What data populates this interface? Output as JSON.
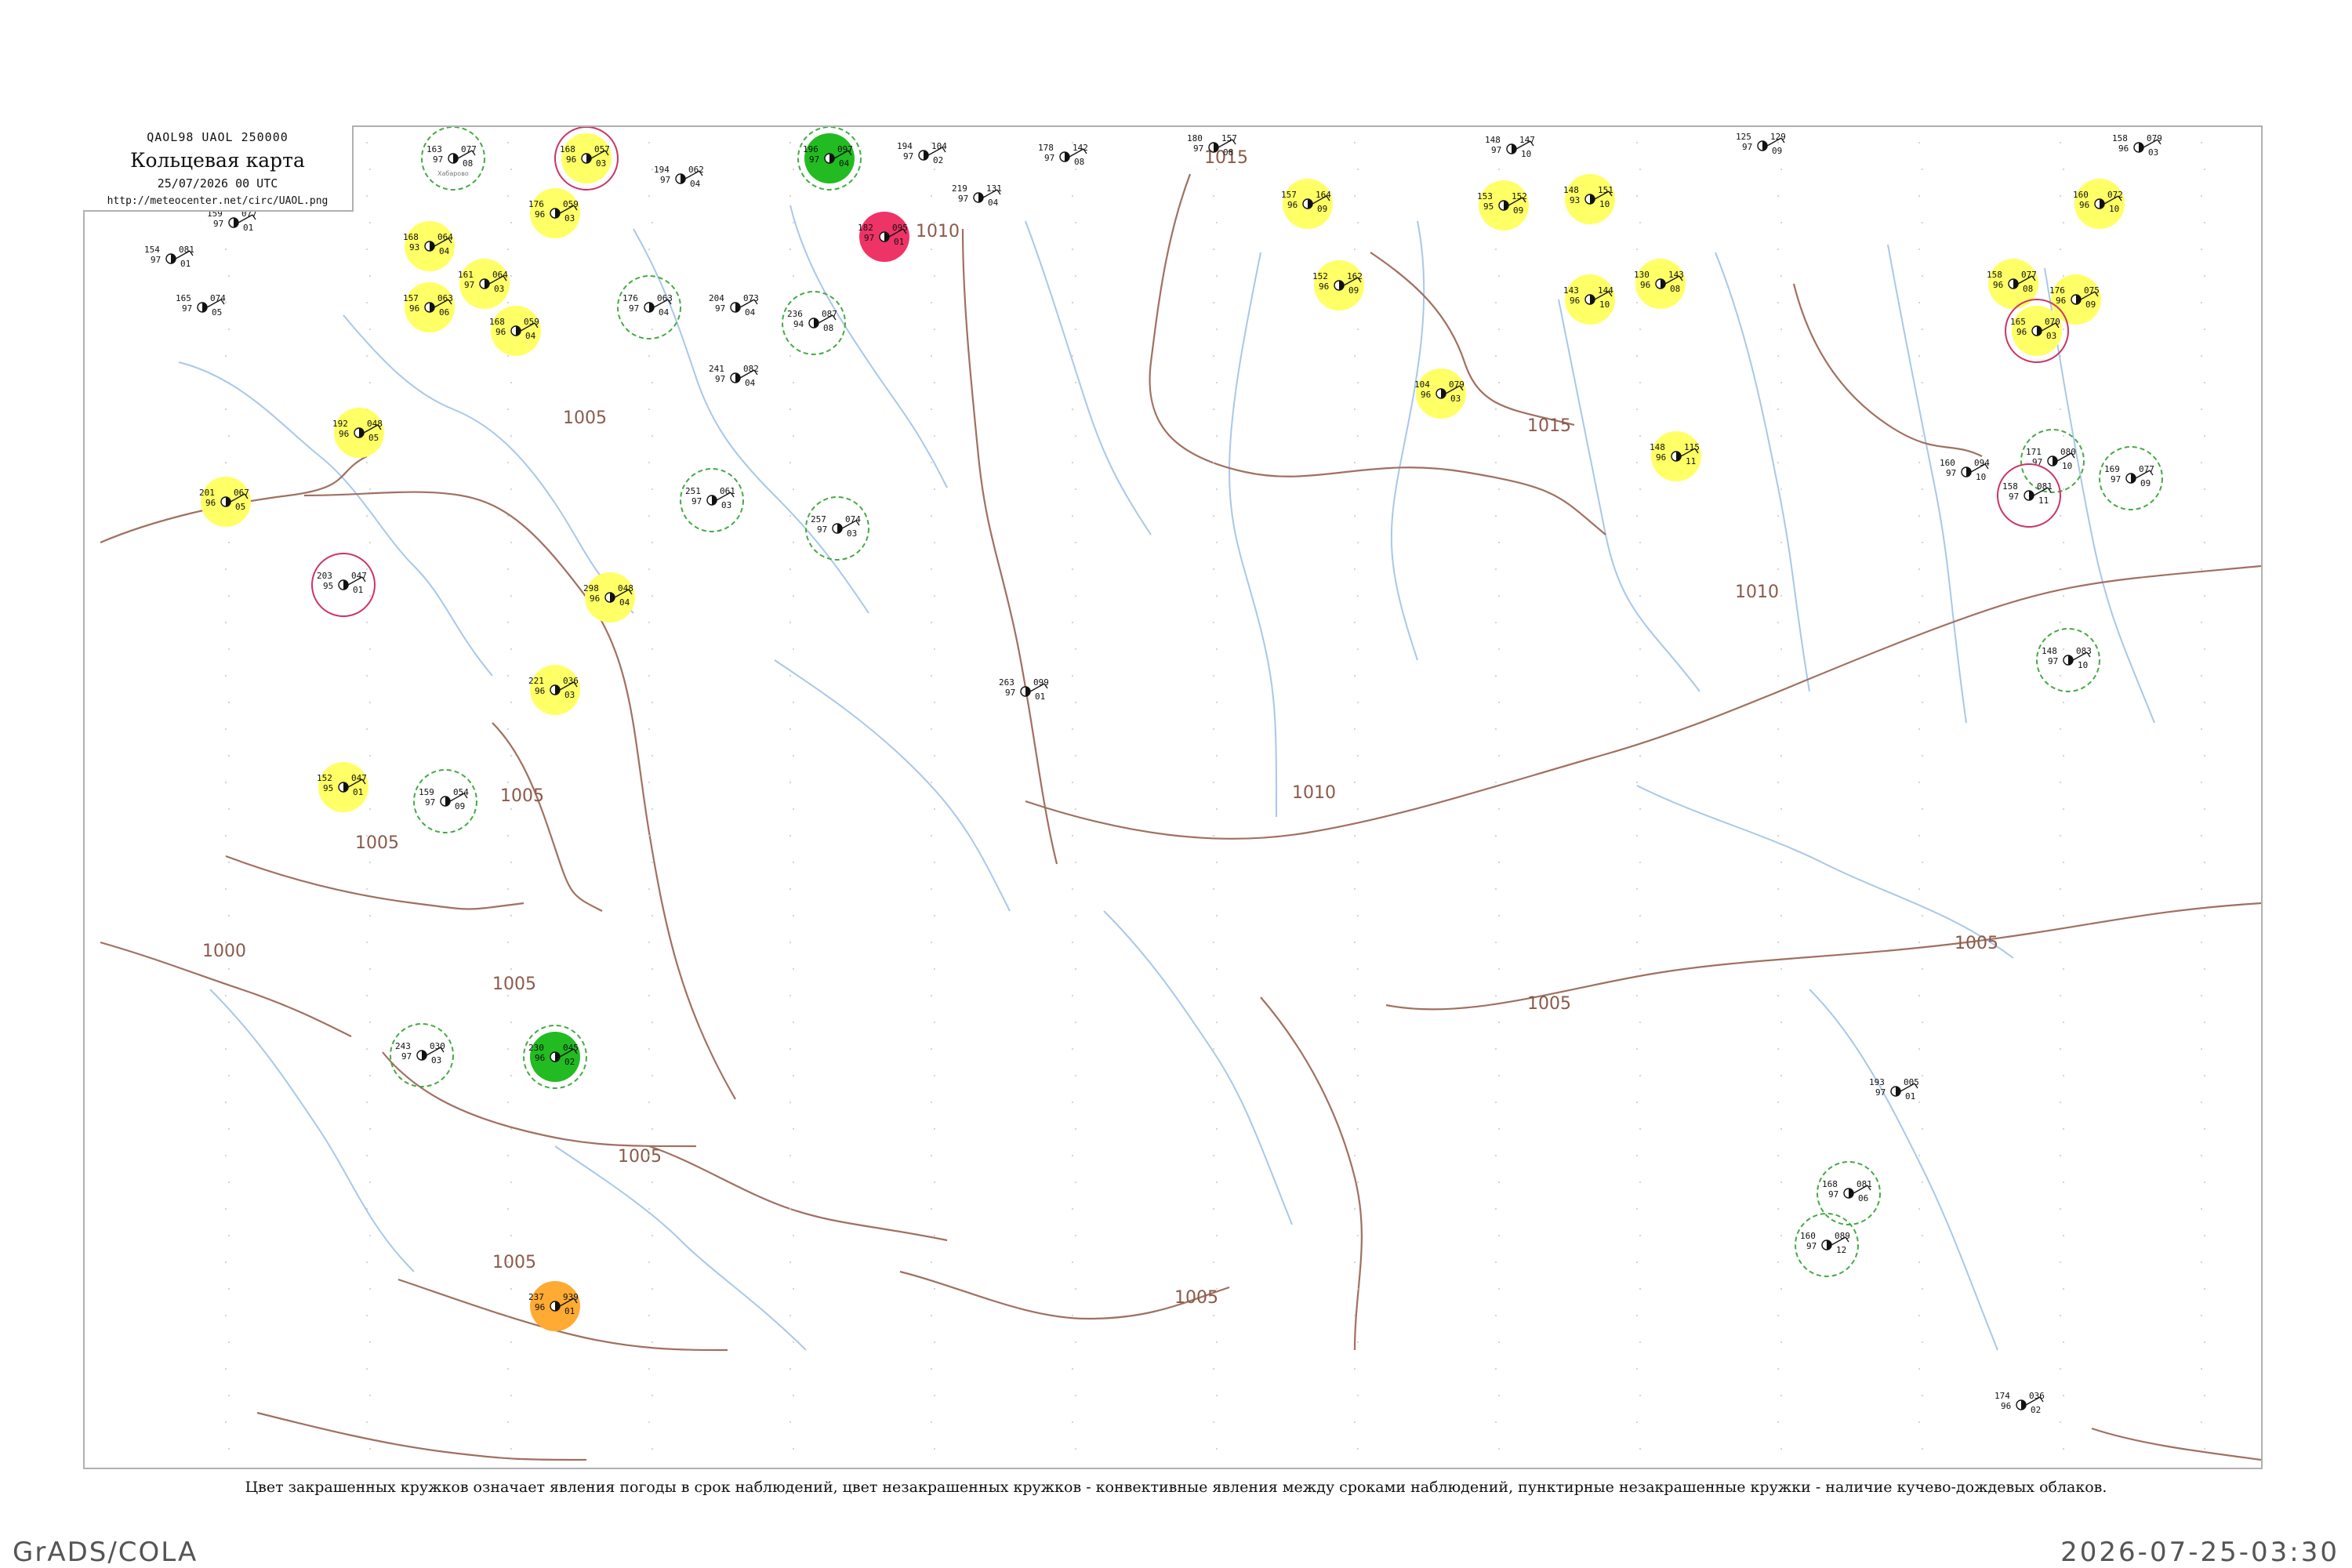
{
  "header": {
    "codes": "QAOL98  UAOL  250000",
    "title": "Кольцевая карта",
    "date": "25/07/2026 00 UTC",
    "url": "http://meteocenter.net/circ/UAOL.png"
  },
  "caption": "Цвет закрашенных кружков означает явления погоды в срок наблюдений, цвет незакрашенных кружков - конвективные явления между сроками наблюдений, пунктирные незакрашенные кружки - наличие кучево-дождевых облаков.",
  "footer": {
    "left": "GrADS/COLA",
    "right": "2026-07-25-03:30"
  },
  "colors": {
    "isobar": "#a07060",
    "river": "#a8c8e8",
    "frame": "#b0b0b0",
    "rain_fill": "#ffff66",
    "shower_fill": "#22bb22",
    "storm_fill": "#ee3366",
    "fog_fill": "#ffaa33",
    "cb_ring": "#44aa44",
    "thunder_ring": "#cc3366"
  },
  "isobar_labels": [
    "1015",
    "1010",
    "1005",
    "1015",
    "1010",
    "1005",
    "1005",
    "1005",
    "1005",
    "1000",
    "1005",
    "1005",
    "1010",
    "1005",
    "1005"
  ],
  "stations": [
    {
      "num": "163",
      "t": "077",
      "tt": "97",
      "v": "08",
      "name": "Хабарово",
      "fill": "none",
      "ring": "cb"
    },
    {
      "num": "168",
      "t": "057",
      "tt": "96",
      "v": "03",
      "name": "",
      "fill": "rain",
      "ring": "thunder"
    },
    {
      "num": "194",
      "t": "062",
      "tt": "97",
      "v": "04",
      "name": "",
      "fill": "none",
      "ring": "none"
    },
    {
      "num": "196",
      "t": "097",
      "tt": "97",
      "v": "04",
      "name": "",
      "fill": "shower",
      "ring": "cb"
    },
    {
      "num": "194",
      "t": "104",
      "tt": "97",
      "v": "02",
      "name": "",
      "fill": "none",
      "ring": "none"
    },
    {
      "num": "178",
      "t": "142",
      "tt": "97",
      "v": "08",
      "name": "",
      "fill": "none",
      "ring": "none"
    },
    {
      "num": "180",
      "t": "157",
      "tt": "97",
      "v": "08",
      "name": "",
      "fill": "none",
      "ring": "none"
    },
    {
      "num": "148",
      "t": "147",
      "tt": "97",
      "v": "10",
      "name": "",
      "fill": "none",
      "ring": "none"
    },
    {
      "num": "125",
      "t": "129",
      "tt": "97",
      "v": "09",
      "name": "",
      "fill": "none",
      "ring": "none"
    },
    {
      "num": "158",
      "t": "079",
      "tt": "96",
      "v": "03",
      "name": "",
      "fill": "none",
      "ring": "none"
    },
    {
      "num": "159",
      "t": "077",
      "tt": "97",
      "v": "01",
      "name": "",
      "fill": "none",
      "ring": "none"
    },
    {
      "num": "168",
      "t": "064",
      "tt": "93",
      "v": "04",
      "name": "",
      "fill": "rain",
      "ring": "none"
    },
    {
      "num": "176",
      "t": "059",
      "tt": "96",
      "v": "03",
      "name": "",
      "fill": "rain",
      "ring": "none"
    },
    {
      "num": "182",
      "t": "095",
      "tt": "97",
      "v": "01",
      "name": "",
      "fill": "storm",
      "ring": "none"
    },
    {
      "num": "219",
      "t": "131",
      "tt": "97",
      "v": "04",
      "name": "",
      "fill": "none",
      "ring": "none"
    },
    {
      "num": "157",
      "t": "164",
      "tt": "96",
      "v": "09",
      "name": "",
      "fill": "rain",
      "ring": "none"
    },
    {
      "num": "153",
      "t": "152",
      "tt": "95",
      "v": "09",
      "name": "",
      "fill": "rain",
      "ring": "none"
    },
    {
      "num": "148",
      "t": "151",
      "tt": "93",
      "v": "10",
      "name": "",
      "fill": "rain",
      "ring": "none"
    },
    {
      "num": "160",
      "t": "072",
      "tt": "96",
      "v": "10",
      "name": "",
      "fill": "rain",
      "ring": "none"
    },
    {
      "num": "154",
      "t": "081",
      "tt": "97",
      "v": "01",
      "name": "",
      "fill": "none",
      "ring": "none"
    },
    {
      "num": "165",
      "t": "074",
      "tt": "97",
      "v": "05",
      "name": "",
      "fill": "none",
      "ring": "none"
    },
    {
      "num": "157",
      "t": "063",
      "tt": "96",
      "v": "06",
      "name": "",
      "fill": "rain",
      "ring": "none"
    },
    {
      "num": "161",
      "t": "064",
      "tt": "97",
      "v": "03",
      "name": "",
      "fill": "rain",
      "ring": "none"
    },
    {
      "num": "204",
      "t": "073",
      "tt": "97",
      "v": "04",
      "name": "",
      "fill": "none",
      "ring": "none"
    },
    {
      "num": "236",
      "t": "087",
      "tt": "94",
      "v": "08",
      "name": "",
      "fill": "none",
      "ring": "cb"
    },
    {
      "num": "152",
      "t": "162",
      "tt": "96",
      "v": "09",
      "name": "",
      "fill": "rain",
      "ring": "none"
    },
    {
      "num": "143",
      "t": "144",
      "tt": "96",
      "v": "10",
      "name": "",
      "fill": "rain",
      "ring": "none"
    },
    {
      "num": "130",
      "t": "143",
      "tt": "96",
      "v": "08",
      "name": "",
      "fill": "rain",
      "ring": "none"
    },
    {
      "num": "158",
      "t": "077",
      "tt": "96",
      "v": "08",
      "name": "",
      "fill": "rain",
      "ring": "none"
    },
    {
      "num": "176",
      "t": "075",
      "tt": "96",
      "v": "09",
      "name": "",
      "fill": "rain",
      "ring": "none"
    },
    {
      "num": "168",
      "t": "059",
      "tt": "96",
      "v": "04",
      "name": "",
      "fill": "rain",
      "ring": "none"
    },
    {
      "num": "176",
      "t": "063",
      "tt": "97",
      "v": "04",
      "name": "",
      "fill": "none",
      "ring": "cb"
    },
    {
      "num": "241",
      "t": "082",
      "tt": "97",
      "v": "04",
      "name": "",
      "fill": "none",
      "ring": "none"
    },
    {
      "num": "104",
      "t": "079",
      "tt": "96",
      "v": "03",
      "name": "",
      "fill": "rain",
      "ring": "none"
    },
    {
      "num": "165",
      "t": "070",
      "tt": "96",
      "v": "03",
      "name": "",
      "fill": "rain",
      "ring": "thunder"
    },
    {
      "num": "192",
      "t": "048",
      "tt": "96",
      "v": "05",
      "name": "",
      "fill": "rain",
      "ring": "none"
    },
    {
      "num": "148",
      "t": "115",
      "tt": "96",
      "v": "11",
      "name": "",
      "fill": "rain",
      "ring": "none"
    },
    {
      "num": "201",
      "t": "067",
      "tt": "96",
      "v": "05",
      "name": "",
      "fill": "rain",
      "ring": "none"
    },
    {
      "num": "251",
      "t": "061",
      "tt": "97",
      "v": "03",
      "name": "",
      "fill": "none",
      "ring": "cb"
    },
    {
      "num": "160",
      "t": "094",
      "tt": "97",
      "v": "10",
      "name": "",
      "fill": "none",
      "ring": "none"
    },
    {
      "num": "171",
      "t": "080",
      "tt": "97",
      "v": "10",
      "name": "",
      "fill": "none",
      "ring": "cb"
    },
    {
      "num": "169",
      "t": "077",
      "tt": "97",
      "v": "09",
      "name": "",
      "fill": "none",
      "ring": "cb"
    },
    {
      "num": "158",
      "t": "081",
      "tt": "97",
      "v": "11",
      "name": "",
      "fill": "none",
      "ring": "thunder"
    },
    {
      "num": "257",
      "t": "074",
      "tt": "97",
      "v": "03",
      "name": "",
      "fill": "none",
      "ring": "cb"
    },
    {
      "num": "203",
      "t": "047",
      "tt": "95",
      "v": "01",
      "name": "",
      "fill": "none",
      "ring": "thunder"
    },
    {
      "num": "298",
      "t": "048",
      "tt": "96",
      "v": "04",
      "name": "",
      "fill": "rain",
      "ring": "none"
    },
    {
      "num": "148",
      "t": "083",
      "tt": "97",
      "v": "10",
      "name": "",
      "fill": "none",
      "ring": "cb"
    },
    {
      "num": "263",
      "t": "099",
      "tt": "97",
      "v": "01",
      "name": "",
      "fill": "none",
      "ring": "none"
    },
    {
      "num": "221",
      "t": "036",
      "tt": "96",
      "v": "03",
      "name": "",
      "fill": "rain",
      "ring": "none"
    },
    {
      "num": "152",
      "t": "047",
      "tt": "95",
      "v": "01",
      "name": "",
      "fill": "rain",
      "ring": "none"
    },
    {
      "num": "159",
      "t": "054",
      "tt": "97",
      "v": "09",
      "name": "",
      "fill": "none",
      "ring": "cb"
    },
    {
      "num": "243",
      "t": "030",
      "tt": "97",
      "v": "03",
      "name": "",
      "fill": "none",
      "ring": "cb"
    },
    {
      "num": "230",
      "t": "045",
      "tt": "96",
      "v": "02",
      "name": "",
      "fill": "shower",
      "ring": "cb"
    },
    {
      "num": "168",
      "t": "081",
      "tt": "97",
      "v": "06",
      "name": "",
      "fill": "none",
      "ring": "cb"
    },
    {
      "num": "160",
      "t": "089",
      "tt": "97",
      "v": "12",
      "name": "",
      "fill": "none",
      "ring": "cb"
    },
    {
      "num": "237",
      "t": "939",
      "tt": "96",
      "v": "01",
      "name": "",
      "fill": "fog",
      "ring": "none"
    },
    {
      "num": "193",
      "t": "005",
      "tt": "97",
      "v": "01",
      "name": "",
      "fill": "none",
      "ring": "none"
    },
    {
      "num": "174",
      "t": "036",
      "tt": "96",
      "v": "02",
      "name": "",
      "fill": "none",
      "ring": "none"
    }
  ]
}
